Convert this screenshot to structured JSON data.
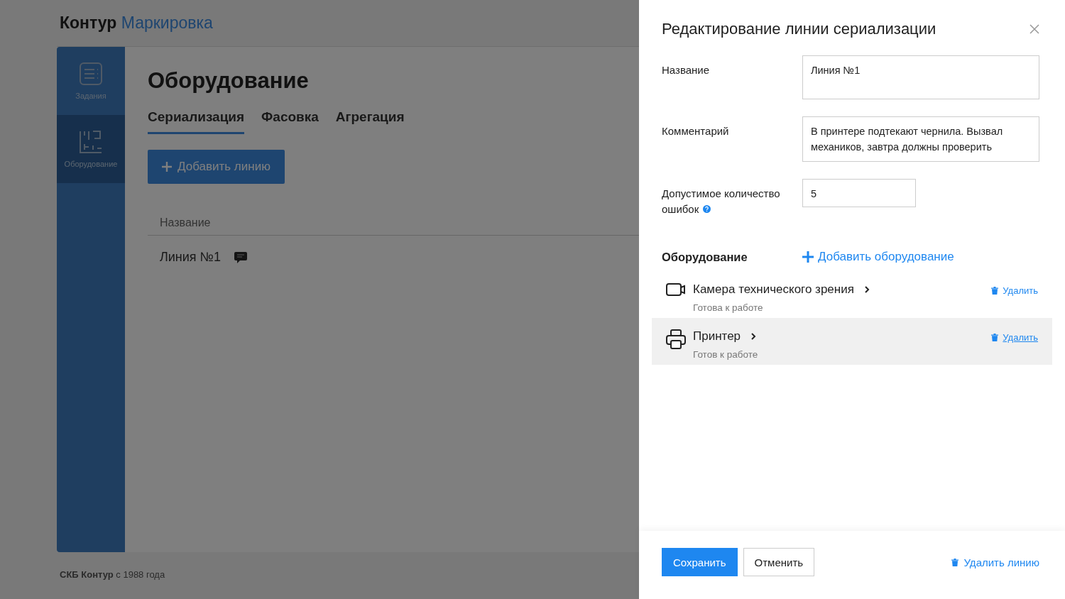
{
  "header": {
    "logo_dark": "Контур",
    "logo_blue": "Маркировка"
  },
  "sidebar": {
    "items": [
      {
        "label": "Задания",
        "kind": "tasks",
        "selected": false
      },
      {
        "label": "Оборудование",
        "kind": "equipment",
        "selected": true
      }
    ]
  },
  "page": {
    "title": "Оборудование",
    "tabs": [
      {
        "label": "Сериализация",
        "selected": true
      },
      {
        "label": "Фасовка",
        "selected": false
      },
      {
        "label": "Агрегация",
        "selected": false
      }
    ],
    "add_button": "Добавить линию",
    "table": {
      "columns": [
        "Название"
      ],
      "rows": [
        {
          "name": "Линия №1",
          "has_comment": true
        }
      ]
    }
  },
  "footer": "**СКБ Контур** с 1988 года",
  "panel": {
    "title": "Редактирование линии сериализации",
    "fields": [
      {
        "label": "Название",
        "value": "Линия №1",
        "kind": "textarea"
      },
      {
        "label": "Комментарий",
        "value": "В принтере подтекают чернила. Вызвал механиков, завтра должны проверить",
        "kind": "textarea"
      },
      {
        "label": "Допустимое количество ошибок",
        "value": "5",
        "kind": "number",
        "help": true
      }
    ],
    "equipment_heading": "Оборудование",
    "add_equipment": "Добавить оборудование",
    "equipment": [
      {
        "name": "Камера технического зрения",
        "status": "Готова к работе",
        "kind": "camera",
        "delete": "Удалить",
        "highlighted": false
      },
      {
        "name": "Принтер",
        "status": "Готов к работе",
        "kind": "printer",
        "delete": "Удалить",
        "highlighted": true
      }
    ],
    "save": "Сохранить",
    "cancel": "Отменить",
    "delete_line": "Удалить линию"
  }
}
